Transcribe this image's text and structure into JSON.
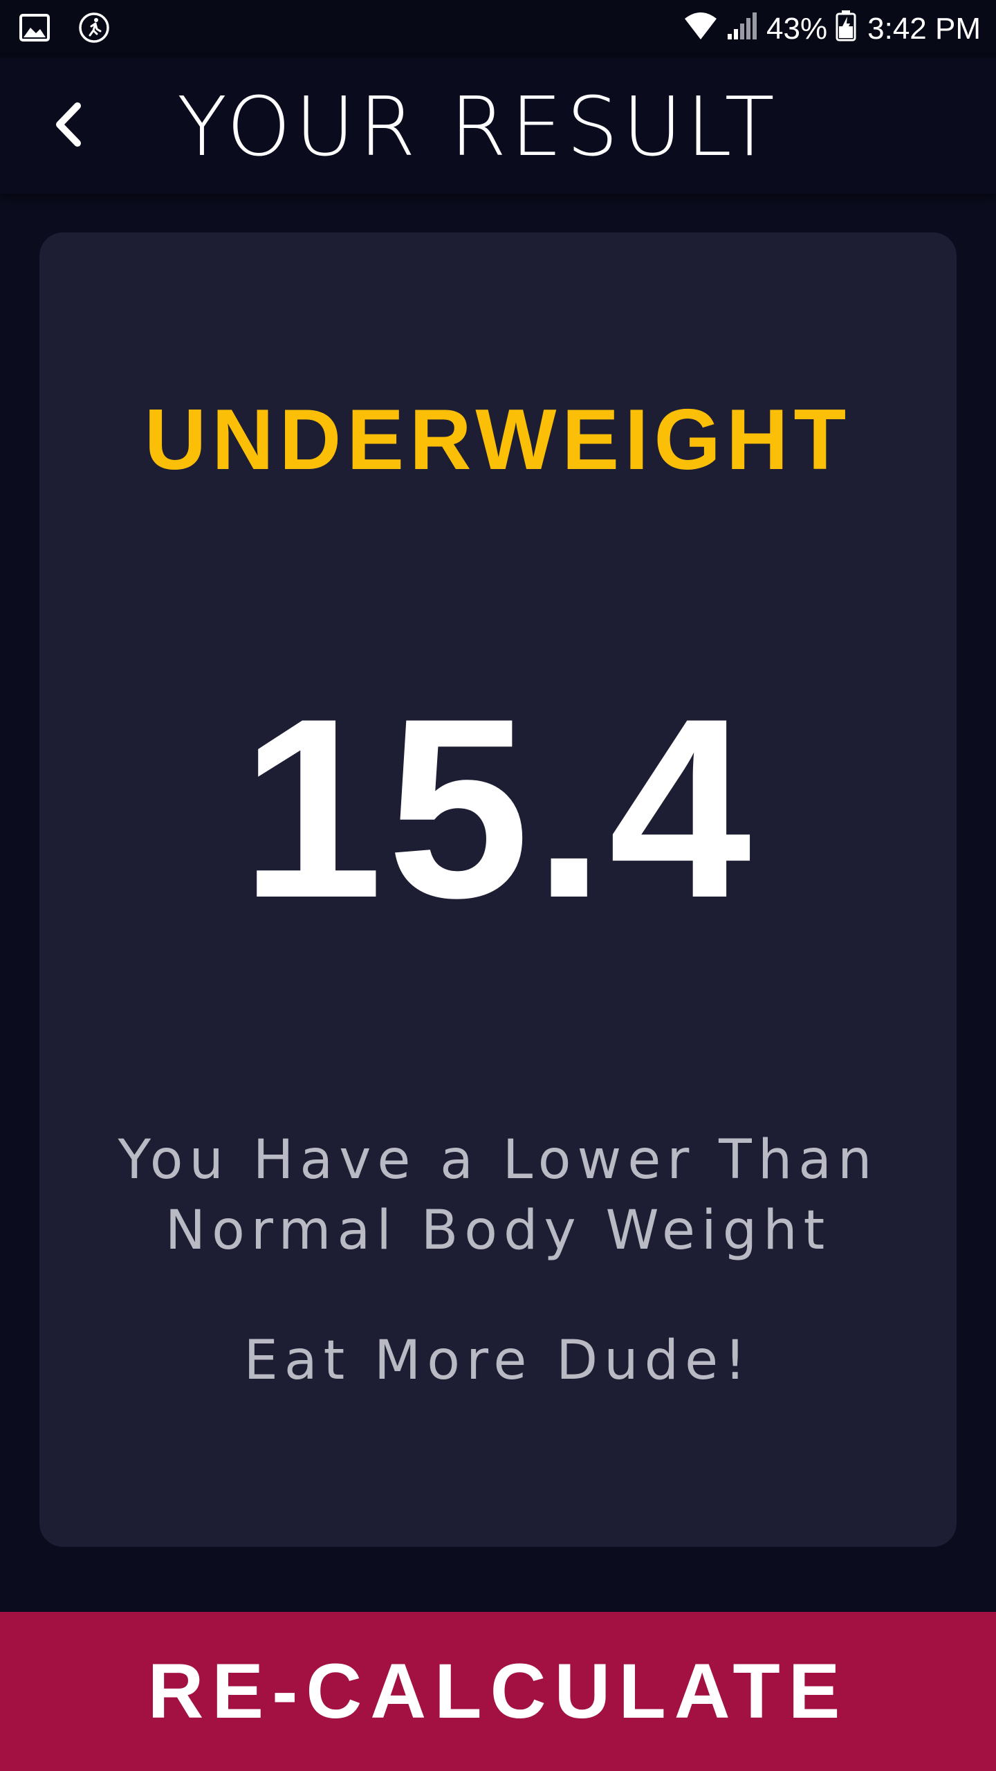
{
  "status_bar": {
    "icons_left": [
      "gallery-icon",
      "running-icon"
    ],
    "icons_right": [
      "wifi-icon",
      "signal-icon",
      "battery-icon"
    ],
    "battery_percent": "43%",
    "time": "3:42 PM"
  },
  "app_bar": {
    "back_icon": "chevron-left-icon",
    "title": "YOUR RESULT"
  },
  "result": {
    "category": "UNDERWEIGHT",
    "bmi": "15.4",
    "message_line1": "You Have a Lower Than",
    "message_line2": "Normal Body Weight",
    "advice": "Eat More Dude!"
  },
  "footer": {
    "recalculate_label": "RE-CALCULATE"
  },
  "colors": {
    "background": "#0b0c1e",
    "card": "#1d1e33",
    "category": "#fbbf07",
    "button": "#a31143",
    "text_secondary": "#b9bac3"
  }
}
